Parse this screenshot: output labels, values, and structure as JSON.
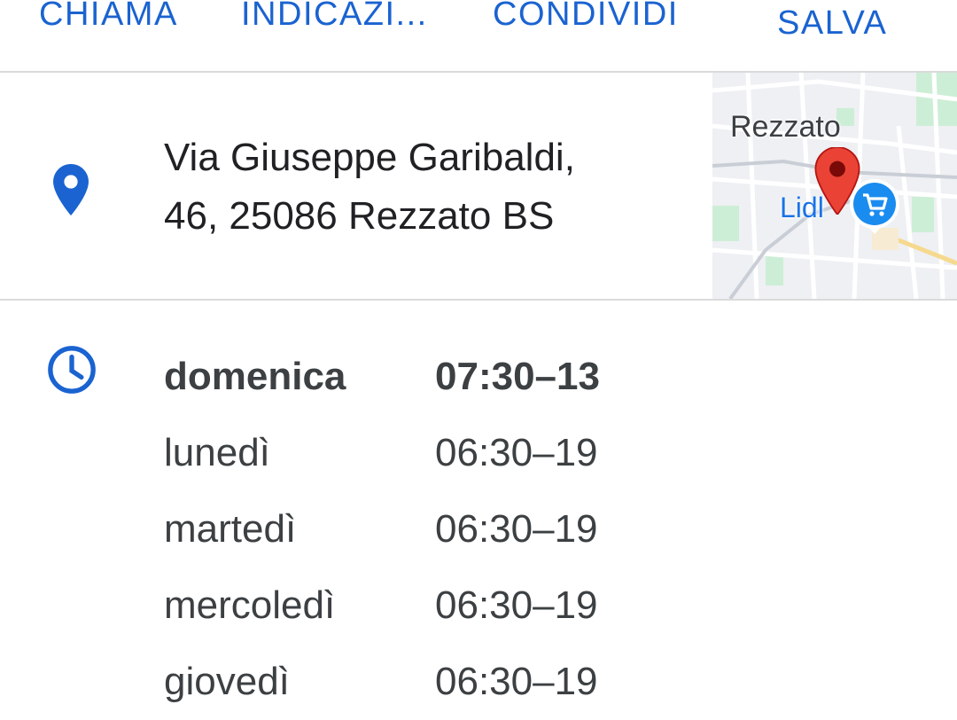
{
  "actions": {
    "call_label": "CHIAMA",
    "directions_label": "INDICAZI...",
    "share_label": "CONDIVIDI",
    "save_label": "SALVA"
  },
  "place": {
    "address_line1": "Via Giuseppe Garibaldi,",
    "address_line2": "46, 25086 Rezzato BS",
    "address_icon": "location-pin-icon"
  },
  "map_thumbnail": {
    "city_label": "Rezzato",
    "poi_label": "Lidl",
    "marker_icon": "red-map-marker-icon",
    "poi_icon": "shopping-cart-icon"
  },
  "hours": {
    "icon": "clock-icon",
    "days": [
      {
        "day": "domenica",
        "time": "07:30–13",
        "today": true
      },
      {
        "day": "lunedì",
        "time": "06:30–19",
        "today": false
      },
      {
        "day": "martedì",
        "time": "06:30–19",
        "today": false
      },
      {
        "day": "mercoledì",
        "time": "06:30–19",
        "today": false
      },
      {
        "day": "giovedì",
        "time": "06:30–19",
        "today": false
      }
    ]
  },
  "colors": {
    "accent_blue": "#1a63d1",
    "text_primary": "#202124",
    "text_secondary": "#3c4043",
    "divider": "#dadada",
    "marker_red": "#ea4335"
  }
}
